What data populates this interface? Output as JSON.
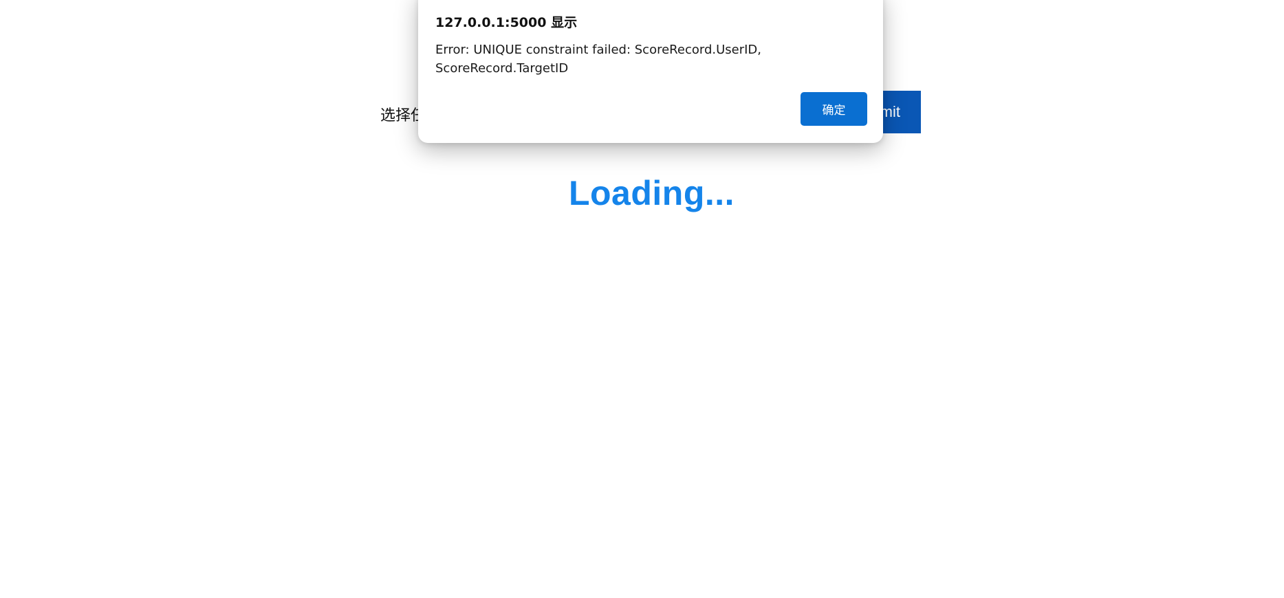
{
  "page": {
    "form_label": "选择任",
    "submit_label": "mit",
    "loading_text": "Loading..."
  },
  "dialog": {
    "title": "127.0.0.1:5000 显示",
    "message_lines": [
      "Error: UNIQUE constraint failed: ScoreRecord.UserID,",
      "ScoreRecord.TargetID"
    ],
    "ok_label": "确定"
  },
  "colors": {
    "submit_bg": "#0a57b5",
    "loading_text": "#1584ea",
    "ok_button_bg": "#0a6fd1"
  }
}
